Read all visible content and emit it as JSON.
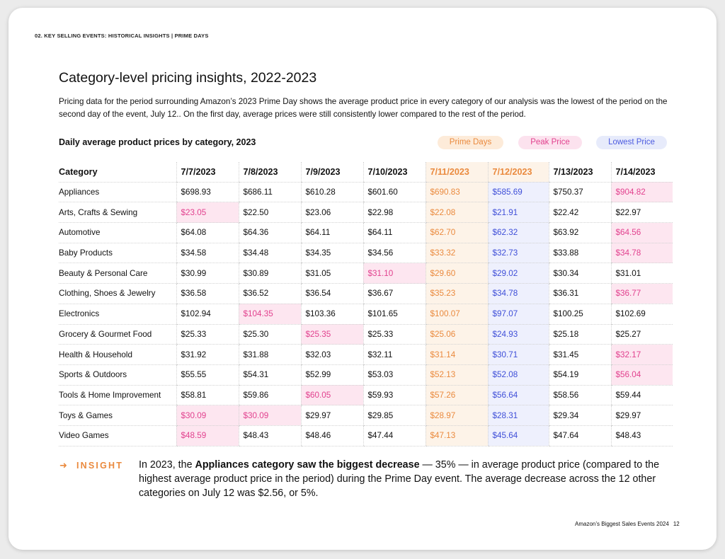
{
  "running_head": "02. KEY SELLING EVENTS: HISTORICAL INSIGHTS  | PRIME DAYS",
  "title": "Category-level pricing insights, 2022-2023",
  "intro": "Pricing data for the period surrounding Amazon’s 2023 Prime Day shows the average product price in every category of our analysis was the lowest of the period on the second day of the event, July 12.. On the first day, average prices were still consistently lower compared to the rest of the period.",
  "table_title": "Daily average product prices by category, 2023",
  "legend": {
    "prime": "Prime Days",
    "peak": "Peak Price",
    "lowest": "Lowest Price"
  },
  "colors": {
    "prime": "#ea8a3e",
    "peak": "#e2428f",
    "lowest": "#4c5be0"
  },
  "table": {
    "category_header": "Category",
    "dates": [
      "7/7/2023",
      "7/8/2023",
      "7/9/2023",
      "7/10/2023",
      "7/11/2023",
      "7/12/2023",
      "7/13/2023",
      "7/14/2023"
    ],
    "prime_columns": [
      4,
      5
    ],
    "rows": [
      {
        "category": "Appliances",
        "values": [
          "$698.93",
          "$686.11",
          "$610.28",
          "$601.60",
          "$690.83",
          "$585.69",
          "$750.37",
          "$904.82"
        ],
        "peak": 7,
        "lowest": 5
      },
      {
        "category": "Arts, Crafts & Sewing",
        "values": [
          "$23.05",
          "$22.50",
          "$23.06",
          "$22.98",
          "$22.08",
          "$21.91",
          "$22.42",
          "$22.97"
        ],
        "peak": 0,
        "lowest": 5
      },
      {
        "category": "Automotive",
        "values": [
          "$64.08",
          "$64.36",
          "$64.11",
          "$64.11",
          "$62.70",
          "$62.32",
          "$63.92",
          "$64.56"
        ],
        "peak": 7,
        "lowest": 5
      },
      {
        "category": "Baby Products",
        "values": [
          "$34.58",
          "$34.48",
          "$34.35",
          "$34.56",
          "$33.32",
          "$32.73",
          "$33.88",
          "$34.78"
        ],
        "peak": 7,
        "lowest": 5
      },
      {
        "category": "Beauty & Personal Care",
        "values": [
          "$30.99",
          "$30.89",
          "$31.05",
          "$31.10",
          "$29.60",
          "$29.02",
          "$30.34",
          "$31.01"
        ],
        "peak": 3,
        "lowest": 5
      },
      {
        "category": "Clothing, Shoes & Jewelry",
        "values": [
          "$36.58",
          "$36.52",
          "$36.54",
          "$36.67",
          "$35.23",
          "$34.78",
          "$36.31",
          "$36.77"
        ],
        "peak": 7,
        "lowest": 5
      },
      {
        "category": "Electronics",
        "values": [
          "$102.94",
          "$104.35",
          "$103.36",
          "$101.65",
          "$100.07",
          "$97.07",
          "$100.25",
          "$102.69"
        ],
        "peak": 1,
        "lowest": 5
      },
      {
        "category": "Grocery & Gourmet Food",
        "values": [
          "$25.33",
          "$25.30",
          "$25.35",
          "$25.33",
          "$25.06",
          "$24.93",
          "$25.18",
          "$25.27"
        ],
        "peak": 2,
        "lowest": 5
      },
      {
        "category": "Health & Household",
        "values": [
          "$31.92",
          "$31.88",
          "$32.03",
          "$32.11",
          "$31.14",
          "$30.71",
          "$31.45",
          "$32.17"
        ],
        "peak": 7,
        "lowest": 5
      },
      {
        "category": "Sports & Outdoors",
        "values": [
          "$55.55",
          "$54.31",
          "$52.99",
          "$53.03",
          "$52.13",
          "$52.08",
          "$54.19",
          "$56.04"
        ],
        "peak": 7,
        "lowest": 5
      },
      {
        "category": "Tools & Home Improvement",
        "values": [
          "$58.81",
          "$59.86",
          "$60.05",
          "$59.93",
          "$57.26",
          "$56.64",
          "$58.56",
          "$59.44"
        ],
        "peak": 2,
        "lowest": 5
      },
      {
        "category": "Toys & Games",
        "values": [
          "$30.09",
          "$30.09",
          "$29.97",
          "$29.85",
          "$28.97",
          "$28.31",
          "$29.34",
          "$29.97"
        ],
        "peak": [
          0,
          1
        ],
        "lowest": 5
      },
      {
        "category": "Video Games",
        "values": [
          "$48.59",
          "$48.43",
          "$48.46",
          "$47.44",
          "$47.13",
          "$45.64",
          "$47.64",
          "$48.43"
        ],
        "peak": 0,
        "lowest": 5
      }
    ]
  },
  "insight": {
    "arrow": "➜",
    "label": "INSIGHT",
    "text_before": "In 2023, the ",
    "text_bold": "Appliances category saw the biggest decrease",
    "text_after": " — 35% — in average product price (compared to the highest average product price in the period) during the Prime Day event. The average decrease across the 12 other categories on July 12 was $2.56, or 5%."
  },
  "footer": {
    "title": "Amazon’s Biggest Sales Events 2024",
    "page_number": "12"
  }
}
